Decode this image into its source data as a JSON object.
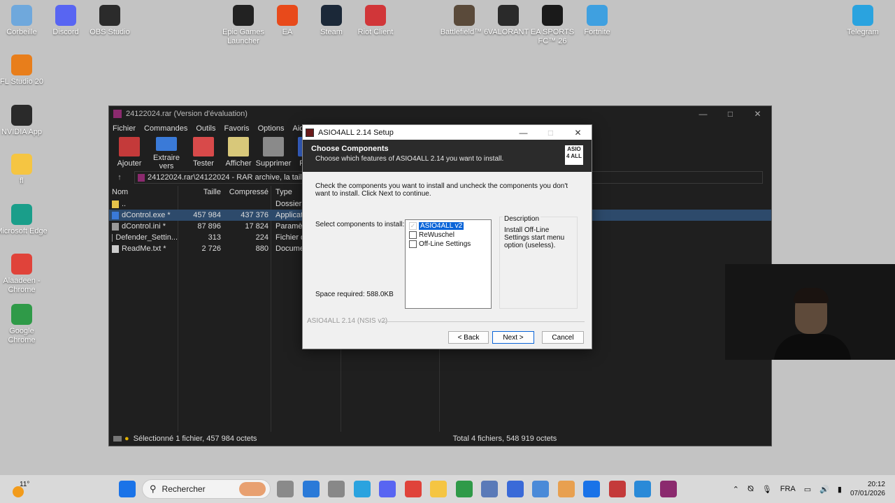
{
  "desktop": {
    "icons": [
      {
        "label": "Corbeille",
        "icon": "recycle-bin-icon",
        "color": "#6fa8dc"
      },
      {
        "label": "Discord",
        "icon": "discord-icon",
        "color": "#5865f2"
      },
      {
        "label": "OBS Studio",
        "icon": "obs-icon",
        "color": "#2b2b2b"
      },
      {
        "label": "Epic Games Launcher",
        "icon": "epic-games-icon",
        "color": "#222222"
      },
      {
        "label": "EA",
        "icon": "ea-icon",
        "color": "#e84a1b"
      },
      {
        "label": "Steam",
        "icon": "steam-icon",
        "color": "#1b2838"
      },
      {
        "label": "Riot Client",
        "icon": "riot-icon",
        "color": "#d13639"
      },
      {
        "label": "Battlefield™ 6",
        "icon": "battlefield-icon",
        "color": "#5a4a3a"
      },
      {
        "label": "VALORANT",
        "icon": "valorant-icon",
        "color": "#2a2a2a"
      },
      {
        "label": "EA SPORTS FC™ 26",
        "icon": "ea-fc-icon",
        "color": "#1a1a1a"
      },
      {
        "label": "Fortnite",
        "icon": "fortnite-icon",
        "color": "#3fa0e0"
      },
      {
        "label": "Telegram",
        "icon": "telegram-icon",
        "color": "#2aa3df"
      },
      {
        "label": "FL Studio 20",
        "icon": "fl-studio-icon",
        "color": "#e87e1b"
      },
      {
        "label": "NVIDIA App",
        "icon": "nvidia-icon",
        "color": "#2a2a2a"
      },
      {
        "label": "fl",
        "icon": "folder-icon",
        "color": "#f5c542"
      },
      {
        "label": "Microsoft Edge",
        "icon": "edge-icon",
        "color": "#1a9e8a"
      },
      {
        "label": "Alaadeen - Chrome",
        "icon": "chrome-icon",
        "color": "#e0433a"
      },
      {
        "label": "Google Chrome",
        "icon": "chrome-icon",
        "color": "#2f9a48"
      }
    ]
  },
  "winrar": {
    "title": "24122024.rar (Version d'évaluation)",
    "menu": [
      "Fichier",
      "Commandes",
      "Outils",
      "Favoris",
      "Options",
      "Aide"
    ],
    "toolbar": [
      "Ajouter",
      "Extraire vers",
      "Tester",
      "Afficher",
      "Supprimer",
      "Rech"
    ],
    "path": "24122024.rar\\24122024 - RAR archive, la taille non",
    "columns": {
      "name": "Nom",
      "size": "Taille",
      "compressed": "Compressé",
      "type": "Type"
    },
    "rows": [
      {
        "name": "..",
        "size": "",
        "compressed": "",
        "type": "Dossier de",
        "selected": false
      },
      {
        "name": "dControl.exe *",
        "size": "457 984",
        "compressed": "437 376",
        "type": "Applicati",
        "selected": true
      },
      {
        "name": "dControl.ini *",
        "size": "87 896",
        "compressed": "17 824",
        "type": "Paramètr",
        "selected": false
      },
      {
        "name": "Defender_Settin...",
        "size": "313",
        "compressed": "224",
        "type": "Fichier de",
        "selected": false
      },
      {
        "name": "ReadMe.txt *",
        "size": "2 726",
        "compressed": "880",
        "type": "Documen",
        "selected": false
      }
    ],
    "status_left": "Sélectionné 1 fichier, 457 984 octets",
    "status_right": "Total 4 fichiers, 548 919 octets"
  },
  "setup": {
    "title": "ASIO4ALL 2.14 Setup",
    "header_title": "Choose Components",
    "header_subtitle": "Choose which features of ASIO4ALL 2.14 you want to install.",
    "logo_text": "ASIO 4 ALL",
    "intro": "Check the components you want to install and uncheck the components you don't want to install. Click Next to continue.",
    "select_label": "Select components to install:",
    "components": [
      {
        "label": "ASIO4ALL v2",
        "checked": true,
        "highlighted": true
      },
      {
        "label": "ReWuschel",
        "checked": false,
        "highlighted": false
      },
      {
        "label": "Off-Line Settings",
        "checked": false,
        "highlighted": false
      }
    ],
    "description_label": "Description",
    "description_text": "Install Off-Line Settings start menu option (useless).",
    "space_required": "Space required: 588.0KB",
    "branding": "ASIO4ALL 2.14 (NSIS v2)",
    "buttons": {
      "back": "< Back",
      "next": "Next >",
      "cancel": "Cancel"
    }
  },
  "taskbar": {
    "temperature": "11°",
    "search_placeholder": "Rechercher",
    "language": "FRA",
    "time": "20:12",
    "date": "07/01/2026"
  }
}
